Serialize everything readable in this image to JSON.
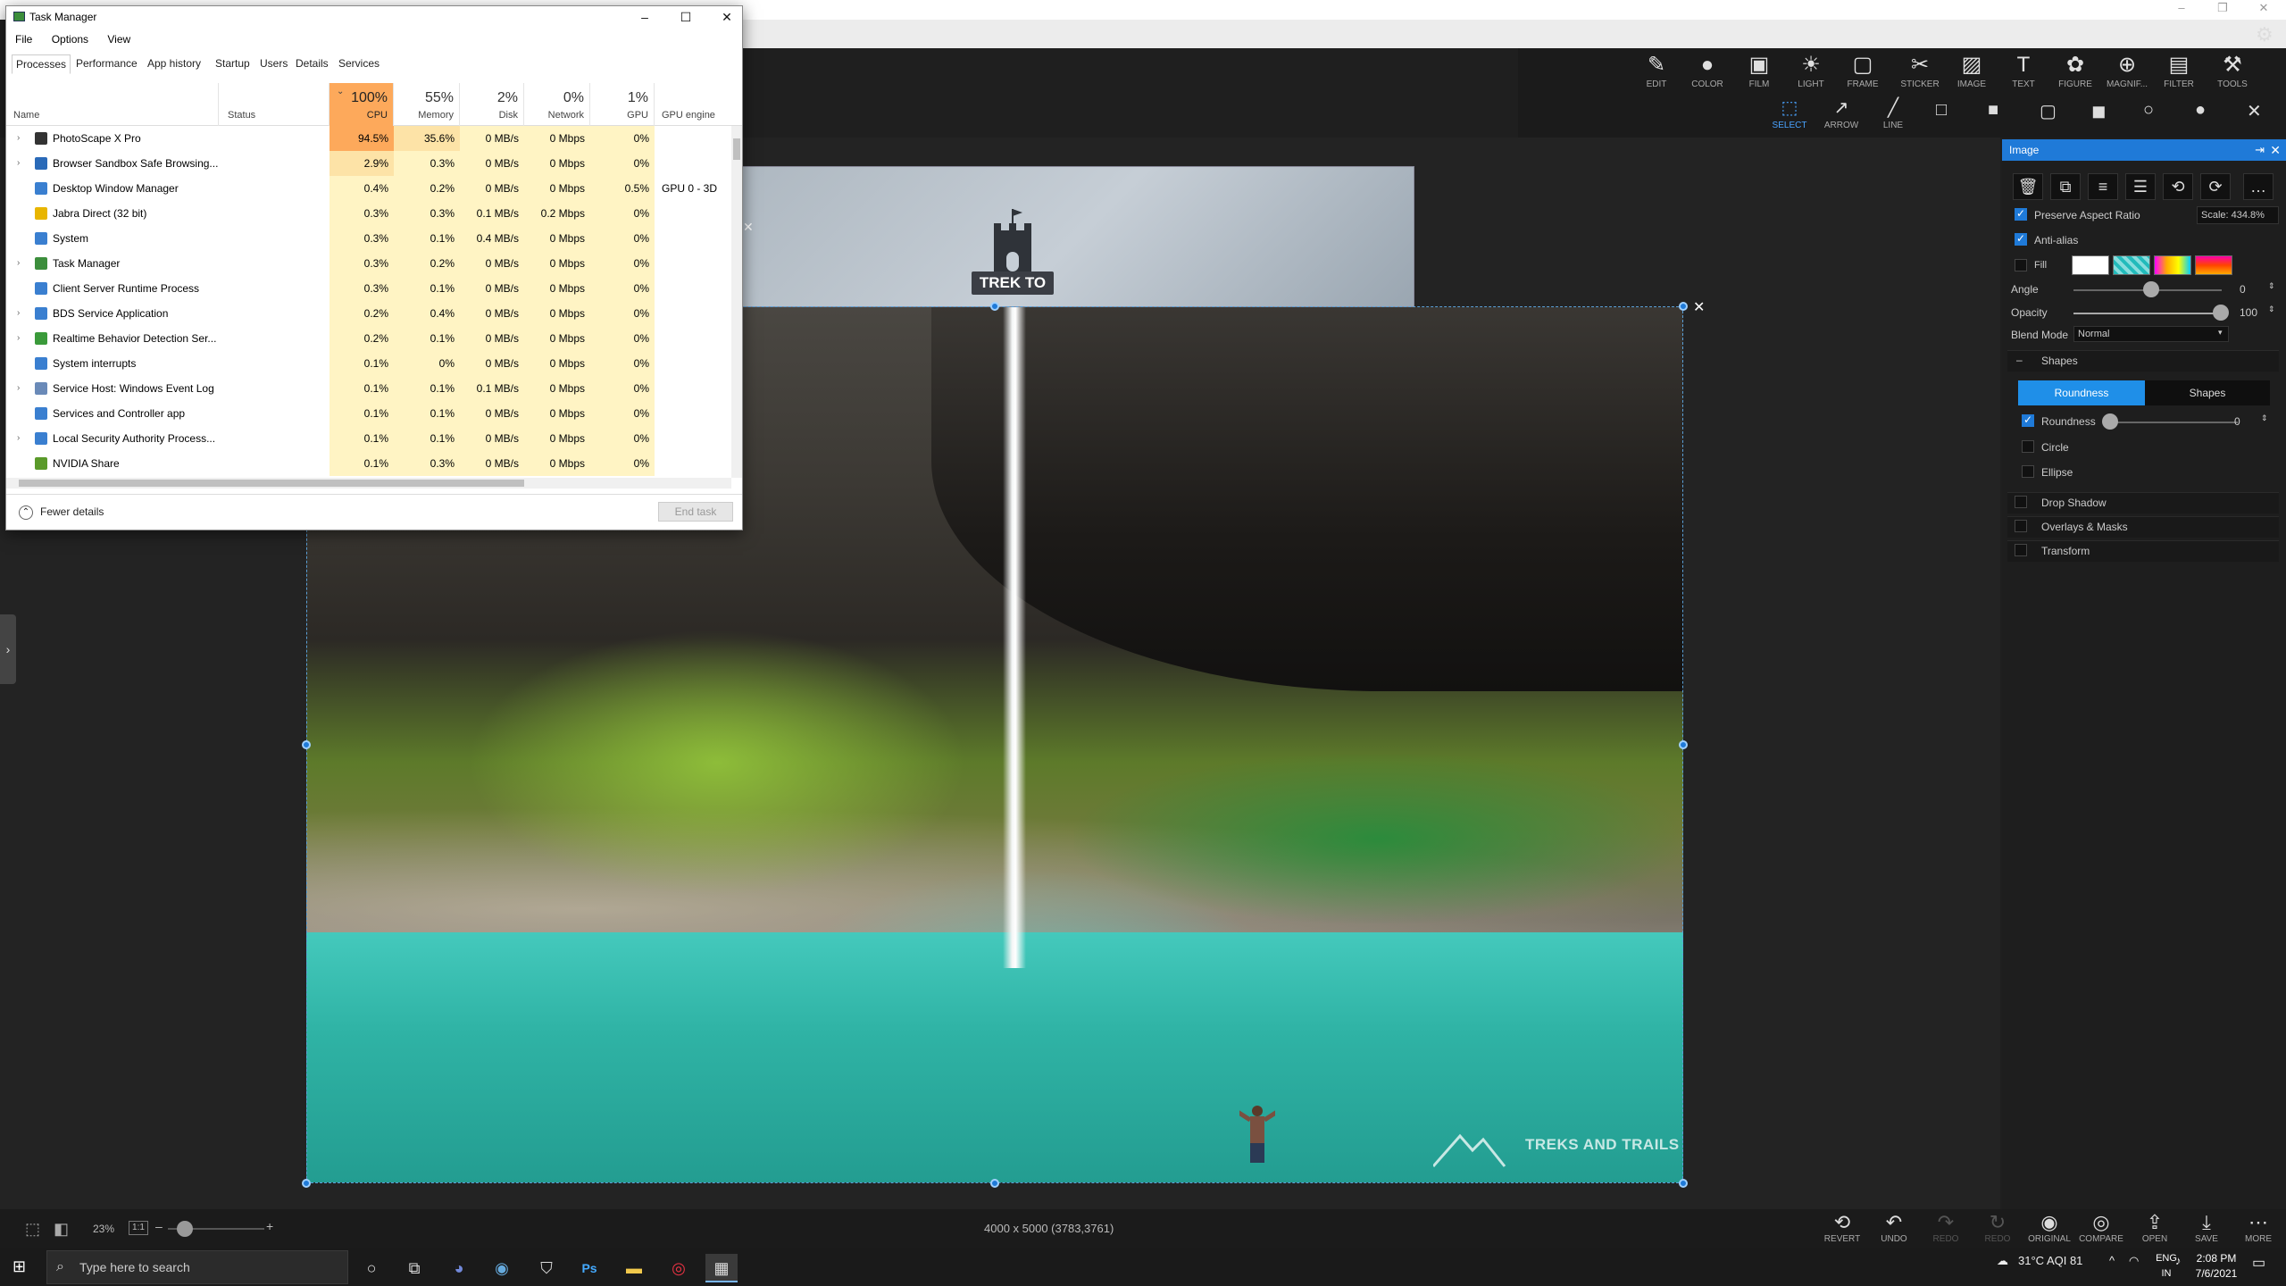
{
  "photoscape": {
    "toolbar": [
      {
        "label": "EDIT",
        "icon": "✎"
      },
      {
        "label": "COLOR",
        "icon": "●"
      },
      {
        "label": "FILM",
        "icon": "▣"
      },
      {
        "label": "LIGHT",
        "icon": "☀"
      },
      {
        "label": "FRAME",
        "icon": "▢"
      },
      {
        "label": "STICKER",
        "icon": "✂"
      },
      {
        "label": "IMAGE",
        "icon": "▨"
      },
      {
        "label": "TEXT",
        "icon": "T"
      },
      {
        "label": "FIGURE",
        "icon": "✿"
      },
      {
        "label": "MAGNIF...",
        "icon": "⊕"
      },
      {
        "label": "FILTER",
        "icon": "▤"
      },
      {
        "label": "TOOLS",
        "icon": "⚒"
      }
    ],
    "subtools": [
      {
        "label": "SELECT",
        "icon": "⬚"
      },
      {
        "label": "ARROW",
        "icon": "↗"
      },
      {
        "label": "LINE",
        "icon": "╱"
      }
    ],
    "shape_icons": [
      "□",
      "■",
      "▢",
      "◼",
      "○",
      "●",
      "✕"
    ],
    "sticker_text": "TREK TO",
    "watermark": "TREKS AND TRAILS",
    "status": {
      "zoom": "23%",
      "ratio": "1:1",
      "dimensions": "4000 x 5000 (3783,3761)"
    },
    "bottom_buttons": [
      {
        "label": "REVERT",
        "icon": "⟲",
        "disabled": false
      },
      {
        "label": "UNDO",
        "icon": "↶",
        "disabled": false
      },
      {
        "label": "REDO",
        "icon": "↷",
        "disabled": true
      },
      {
        "label": "REDO",
        "icon": "↻",
        "disabled": true
      },
      {
        "label": "ORIGINAL",
        "icon": "◉",
        "disabled": false
      },
      {
        "label": "COMPARE",
        "icon": "◎",
        "disabled": false
      },
      {
        "label": "OPEN",
        "icon": "⇪",
        "disabled": false
      },
      {
        "label": "SAVE",
        "icon": "⤓",
        "disabled": false
      },
      {
        "label": "MORE",
        "icon": "⋯",
        "disabled": false
      }
    ],
    "panel": {
      "title": "Image",
      "tool_icons": [
        "🗑",
        "⧉",
        "≡",
        "☰",
        "⟲",
        "⟳",
        "…"
      ],
      "preserve_aspect": "Preserve Aspect Ratio",
      "scale": "Scale: 434.8%",
      "antialias": "Anti-alias",
      "fill": "Fill",
      "angle_label": "Angle",
      "angle_value": "0",
      "opacity_label": "Opacity",
      "opacity_value": "100",
      "blend_label": "Blend Mode",
      "blend_value": "Normal",
      "shapes_section": "Shapes",
      "tab_roundness": "Roundness",
      "tab_shapes": "Shapes",
      "roundness_label": "Roundness",
      "roundness_value": "0",
      "circle": "Circle",
      "ellipse": "Ellipse",
      "drop_shadow": "Drop Shadow",
      "overlays": "Overlays & Masks",
      "transform": "Transform"
    }
  },
  "taskmanager": {
    "title": "Task Manager",
    "menu": [
      "File",
      "Options",
      "View"
    ],
    "tabs": [
      "Processes",
      "Performance",
      "App history",
      "Startup",
      "Users",
      "Details",
      "Services"
    ],
    "headers": {
      "name": "Name",
      "status": "Status",
      "cpu_pct": "100%",
      "cpu": "CPU",
      "mem_pct": "55%",
      "mem": "Memory",
      "disk_pct": "2%",
      "disk": "Disk",
      "net_pct": "0%",
      "net": "Network",
      "gpu_pct": "1%",
      "gpu": "GPU",
      "engine": "GPU engine"
    },
    "rows": [
      {
        "name": "PhotoScape X Pro",
        "exp": true,
        "cpu": "94.5%",
        "mem": "35.6%",
        "disk": "0 MB/s",
        "net": "0 Mbps",
        "gpu": "0%",
        "eng": "",
        "color": "#333"
      },
      {
        "name": "Browser Sandbox Safe Browsing...",
        "exp": true,
        "cpu": "2.9%",
        "mem": "0.3%",
        "disk": "0 MB/s",
        "net": "0 Mbps",
        "gpu": "0%",
        "eng": "",
        "color": "#2a6ab8"
      },
      {
        "name": "Desktop Window Manager",
        "exp": false,
        "cpu": "0.4%",
        "mem": "0.2%",
        "disk": "0 MB/s",
        "net": "0 Mbps",
        "gpu": "0.5%",
        "eng": "GPU 0 - 3D",
        "color": "#3a7fd0"
      },
      {
        "name": "Jabra Direct (32 bit)",
        "exp": false,
        "cpu": "0.3%",
        "mem": "0.3%",
        "disk": "0.1 MB/s",
        "net": "0.2 Mbps",
        "gpu": "0%",
        "eng": "",
        "color": "#e8b500"
      },
      {
        "name": "System",
        "exp": false,
        "cpu": "0.3%",
        "mem": "0.1%",
        "disk": "0.4 MB/s",
        "net": "0 Mbps",
        "gpu": "0%",
        "eng": "",
        "color": "#3a7fd0"
      },
      {
        "name": "Task Manager",
        "exp": true,
        "cpu": "0.3%",
        "mem": "0.2%",
        "disk": "0 MB/s",
        "net": "0 Mbps",
        "gpu": "0%",
        "eng": "",
        "color": "#3c8e3c"
      },
      {
        "name": "Client Server Runtime Process",
        "exp": false,
        "cpu": "0.3%",
        "mem": "0.1%",
        "disk": "0 MB/s",
        "net": "0 Mbps",
        "gpu": "0%",
        "eng": "",
        "color": "#3a7fd0"
      },
      {
        "name": "BDS Service Application",
        "exp": true,
        "cpu": "0.2%",
        "mem": "0.4%",
        "disk": "0 MB/s",
        "net": "0 Mbps",
        "gpu": "0%",
        "eng": "",
        "color": "#3a7fd0"
      },
      {
        "name": "Realtime Behavior Detection Ser...",
        "exp": true,
        "cpu": "0.2%",
        "mem": "0.1%",
        "disk": "0 MB/s",
        "net": "0 Mbps",
        "gpu": "0%",
        "eng": "",
        "color": "#3a9a3a"
      },
      {
        "name": "System interrupts",
        "exp": false,
        "cpu": "0.1%",
        "mem": "0%",
        "disk": "0 MB/s",
        "net": "0 Mbps",
        "gpu": "0%",
        "eng": "",
        "color": "#3a7fd0"
      },
      {
        "name": "Service Host: Windows Event Log",
        "exp": true,
        "cpu": "0.1%",
        "mem": "0.1%",
        "disk": "0.1 MB/s",
        "net": "0 Mbps",
        "gpu": "0%",
        "eng": "",
        "color": "#6a8ab8"
      },
      {
        "name": "Services and Controller app",
        "exp": false,
        "cpu": "0.1%",
        "mem": "0.1%",
        "disk": "0 MB/s",
        "net": "0 Mbps",
        "gpu": "0%",
        "eng": "",
        "color": "#3a7fd0"
      },
      {
        "name": "Local Security Authority Process...",
        "exp": true,
        "cpu": "0.1%",
        "mem": "0.1%",
        "disk": "0 MB/s",
        "net": "0 Mbps",
        "gpu": "0%",
        "eng": "",
        "color": "#3a7fd0"
      },
      {
        "name": "NVIDIA Share",
        "exp": false,
        "cpu": "0.1%",
        "mem": "0.3%",
        "disk": "0 MB/s",
        "net": "0 Mbps",
        "gpu": "0%",
        "eng": "",
        "color": "#5a9a2a"
      }
    ],
    "fewer": "Fewer details",
    "endtask": "End task"
  },
  "taskbar": {
    "search_placeholder": "Type here to search",
    "weather": "31°C AQI 81",
    "lang1": "ENG",
    "lang2": "IN",
    "time": "2:08 PM",
    "date": "7/6/2021"
  }
}
